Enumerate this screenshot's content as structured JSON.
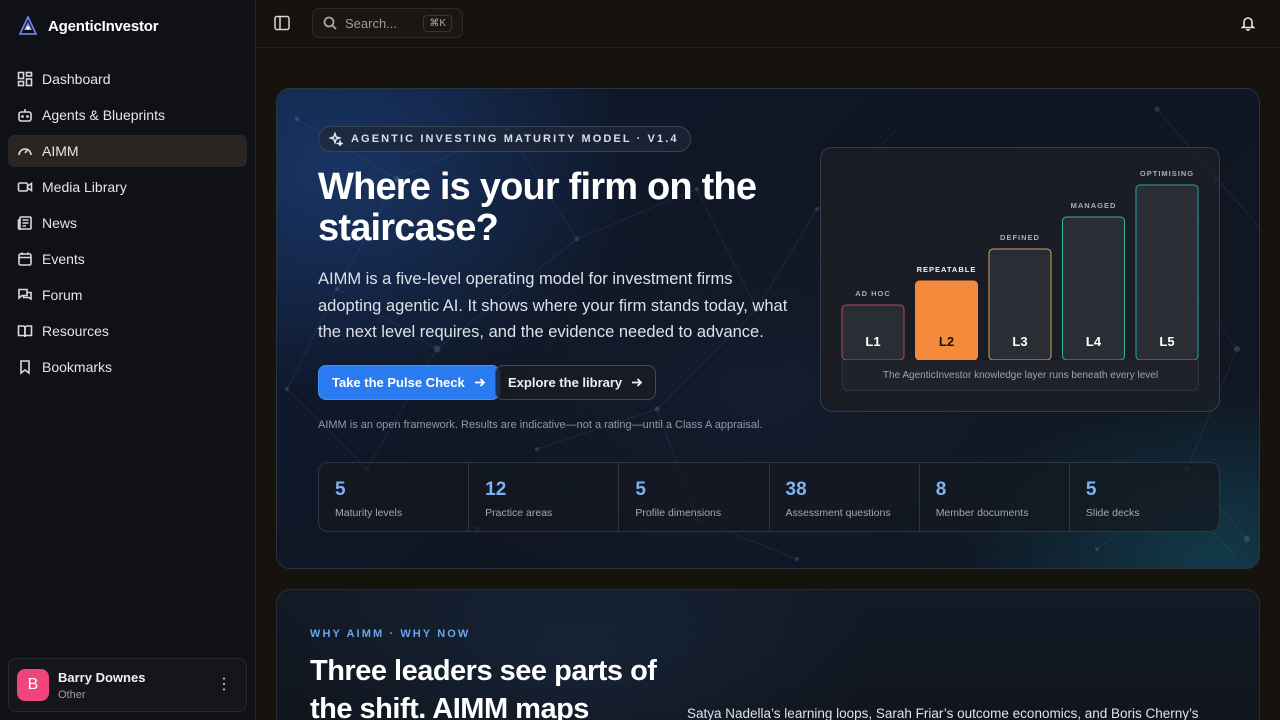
{
  "app": {
    "name": "AgenticInvestor"
  },
  "sidebar": {
    "items": [
      {
        "label": "Dashboard",
        "icon": "dashboard-icon",
        "active": false
      },
      {
        "label": "Agents & Blueprints",
        "icon": "bot-icon",
        "active": false
      },
      {
        "label": "AIMM",
        "icon": "gauge-icon",
        "active": true
      },
      {
        "label": "Media Library",
        "icon": "video-icon",
        "active": false
      },
      {
        "label": "News",
        "icon": "newspaper-icon",
        "active": false
      },
      {
        "label": "Events",
        "icon": "calendar-icon",
        "active": false
      },
      {
        "label": "Forum",
        "icon": "forum-icon",
        "active": false
      },
      {
        "label": "Resources",
        "icon": "book-icon",
        "active": false
      },
      {
        "label": "Bookmarks",
        "icon": "bookmark-icon",
        "active": false
      }
    ],
    "user": {
      "initial": "B",
      "name": "Barry Downes",
      "role": "Other",
      "menu": "⋮"
    }
  },
  "topbar": {
    "search": {
      "placeholder": "Search...",
      "shortcut": "⌘K"
    }
  },
  "hero": {
    "pill": "AGENTIC INVESTING MATURITY MODEL · V1.4",
    "title": "Where is your firm on the staircase?",
    "description": "AIMM is a five-level operating model for investment firms adopting agentic AI. It shows where your firm stands today, what the next level requires, and the evidence needed to advance.",
    "primary_button": "Take the Pulse Check",
    "secondary_button": "Explore the library",
    "note": "AIMM is an open framework. Results are indicative—not a rating—until a Class A appraisal.",
    "staircase": {
      "levels": [
        {
          "code": "L1",
          "name": "AD HOC",
          "color": "#b04a5a",
          "highlight": false
        },
        {
          "code": "L2",
          "name": "REPEATABLE",
          "color": "#f58a3c",
          "highlight": true
        },
        {
          "code": "L3",
          "name": "DEFINED",
          "color": "#c9a55a",
          "highlight": false
        },
        {
          "code": "L4",
          "name": "MANAGED",
          "color": "#2fb39a",
          "highlight": false
        },
        {
          "code": "L5",
          "name": "OPTIMISING",
          "color": "#2f9fa8",
          "highlight": false
        }
      ],
      "footer": "The AgenticInvestor knowledge layer runs beneath every level"
    },
    "stats": [
      {
        "value": "5",
        "label": "Maturity levels"
      },
      {
        "value": "12",
        "label": "Practice areas"
      },
      {
        "value": "5",
        "label": "Profile dimensions"
      },
      {
        "value": "38",
        "label": "Assessment questions"
      },
      {
        "value": "8",
        "label": "Member documents"
      },
      {
        "value": "5",
        "label": "Slide decks"
      }
    ]
  },
  "why": {
    "eyebrow": "WHY AIMM · WHY NOW",
    "title": "Three leaders see parts of the shift. AIMM maps",
    "text": "Satya Nadella’s learning loops, Sarah Friar’s outcome economics, and Boris Cherny’s"
  }
}
